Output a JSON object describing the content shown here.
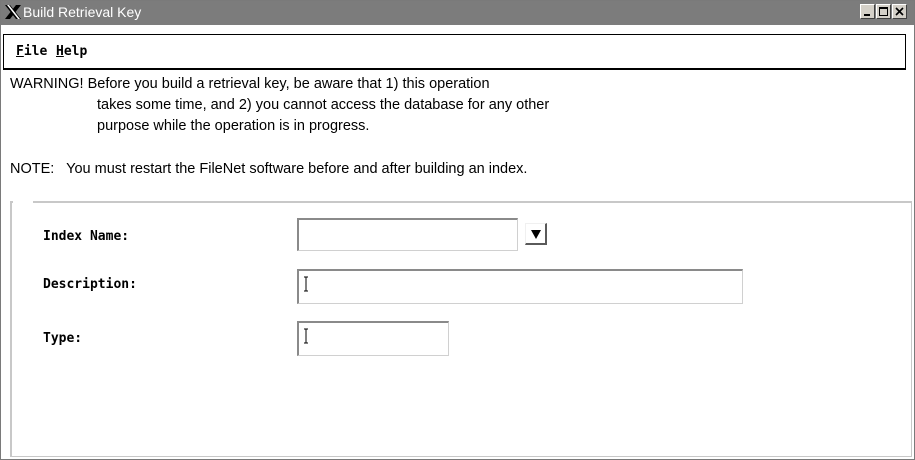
{
  "window": {
    "title": "Build Retrieval Key"
  },
  "menu": {
    "file": {
      "mnemonic": "F",
      "rest": "ile"
    },
    "help": {
      "mnemonic": "H",
      "rest": "elp"
    }
  },
  "messages": {
    "warning_line1": "WARNING! Before you build a retrieval key, be aware that 1) this operation",
    "warning_line2": "takes some time, and 2) you cannot access the database for any other",
    "warning_line3": "purpose while the operation is in progress.",
    "note": "NOTE:   You must restart the FileNet software before and after building an index."
  },
  "form": {
    "index_name": {
      "label": "Index Name:",
      "value": ""
    },
    "description": {
      "label": "Description:",
      "value": ""
    },
    "type": {
      "label": "Type:",
      "value": ""
    }
  },
  "icons": {
    "title": "x-window-icon",
    "minimize": "minimize-icon",
    "maximize": "maximize-icon",
    "close": "close-icon",
    "dropdown": "triangle-down-icon"
  }
}
